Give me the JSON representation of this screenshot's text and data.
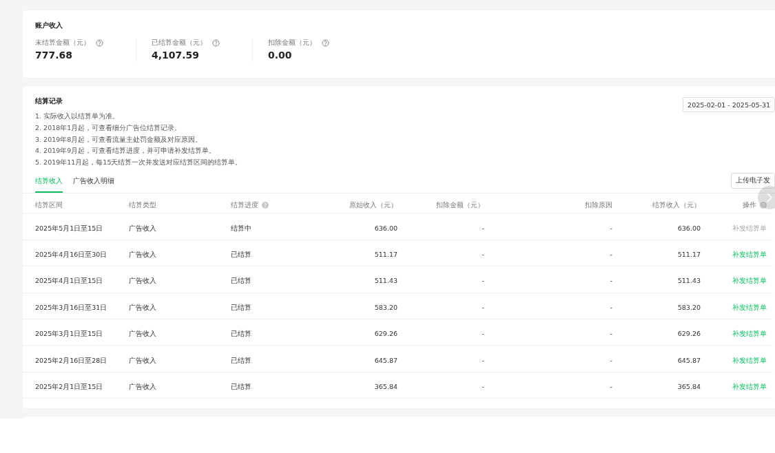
{
  "account_income": {
    "title": "账户收入",
    "stats": [
      {
        "label": "未结算金额（元）",
        "value": "777.68"
      },
      {
        "label": "已结算金额（元）",
        "value": "4,107.59"
      },
      {
        "label": "扣除金额（元）",
        "value": "0.00"
      }
    ]
  },
  "settlement_records": {
    "title": "结算记录",
    "date_range": "2025-02-01 - 2025-05-31",
    "notes": [
      "1. 实际收入以结算单为准。",
      "2. 2018年1月起，可查看细分广告位结算记录。",
      "3. 2019年8月起，可查看流量主处罚金额及对应原因。",
      "4. 2019年9月起，可查看结算进度，并可申请补发结算单。",
      "5. 2019年11月起，每15天结算一次并发送对应结算区间的结算单。"
    ],
    "tabs": [
      {
        "label": "结算收入",
        "selected": true
      },
      {
        "label": "广告收入明细",
        "selected": false
      }
    ],
    "upload_button": "上传电子发",
    "table": {
      "columns": [
        {
          "label": "结算区间",
          "help": false
        },
        {
          "label": "结算类型",
          "help": false
        },
        {
          "label": "结算进度",
          "help": true
        },
        {
          "label": "原始收入（元）",
          "help": false
        },
        {
          "label": "扣除金额（元）",
          "help": false
        },
        {
          "label": "扣除原因",
          "help": false
        },
        {
          "label": "结算收入（元）",
          "help": false
        },
        {
          "label": "操作",
          "help": true
        }
      ],
      "rows": [
        {
          "period": "2025年5月1日至15日",
          "type": "广告收入",
          "progress": "结算中",
          "original": "636.00",
          "deduction": "-",
          "reason": "-",
          "income": "636.00",
          "action": "补发结算单",
          "action_disabled": true
        },
        {
          "period": "2025年4月16日至30日",
          "type": "广告收入",
          "progress": "已结算",
          "original": "511.17",
          "deduction": "-",
          "reason": "-",
          "income": "511.17",
          "action": "补发结算单",
          "action_disabled": false
        },
        {
          "period": "2025年4月1日至15日",
          "type": "广告收入",
          "progress": "已结算",
          "original": "511.43",
          "deduction": "-",
          "reason": "-",
          "income": "511.43",
          "action": "补发结算单",
          "action_disabled": false
        },
        {
          "period": "2025年3月16日至31日",
          "type": "广告收入",
          "progress": "已结算",
          "original": "583.20",
          "deduction": "-",
          "reason": "-",
          "income": "583.20",
          "action": "补发结算单",
          "action_disabled": false
        },
        {
          "period": "2025年3月1日至15日",
          "type": "广告收入",
          "progress": "已结算",
          "original": "629.26",
          "deduction": "-",
          "reason": "-",
          "income": "629.26",
          "action": "补发结算单",
          "action_disabled": false
        },
        {
          "period": "2025年2月16日至28日",
          "type": "广告收入",
          "progress": "已结算",
          "original": "645.87",
          "deduction": "-",
          "reason": "-",
          "income": "645.87",
          "action": "补发结算单",
          "action_disabled": false
        },
        {
          "period": "2025年2月1日至15日",
          "type": "广告收入",
          "progress": "已结算",
          "original": "365.84",
          "deduction": "-",
          "reason": "-",
          "income": "365.84",
          "action": "补发结算单",
          "action_disabled": false
        }
      ]
    }
  }
}
